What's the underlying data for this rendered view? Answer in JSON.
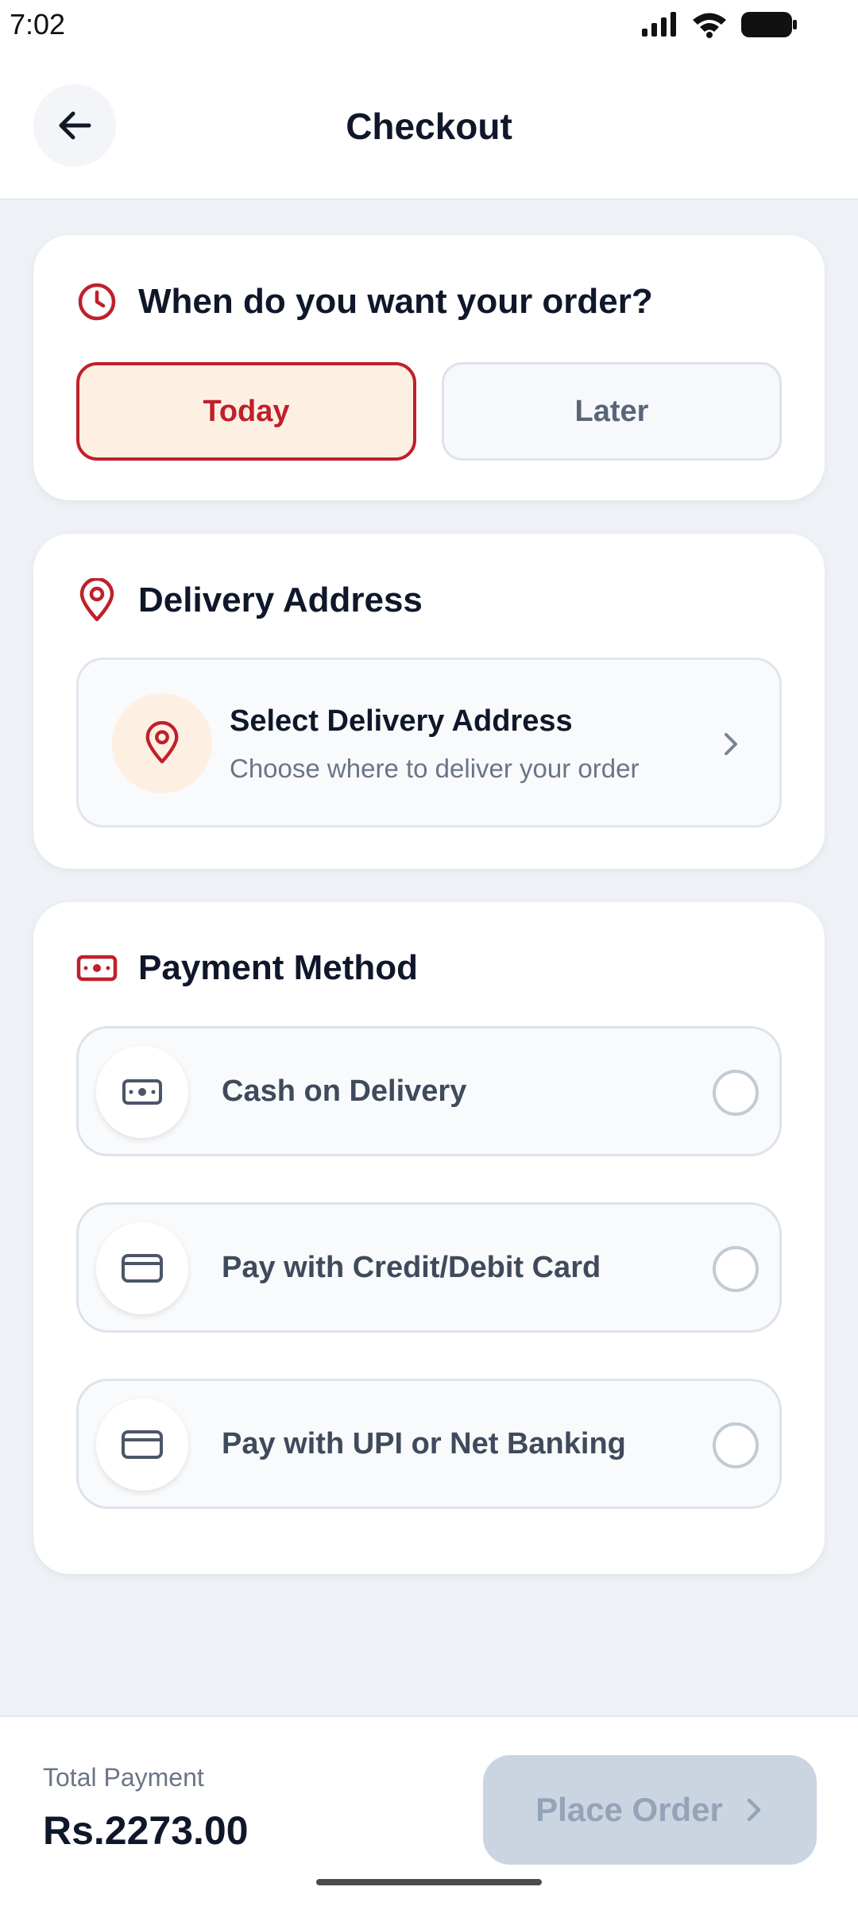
{
  "status_bar": {
    "time": "7:02"
  },
  "header": {
    "title": "Checkout"
  },
  "delivery_time": {
    "title": "When do you want your order?",
    "options": [
      "Today",
      "Later"
    ],
    "selected": "Today"
  },
  "delivery_address": {
    "title": "Delivery Address",
    "select_title": "Select Delivery Address",
    "select_subtitle": "Choose where to deliver your order"
  },
  "payment": {
    "title": "Payment Method",
    "options": [
      {
        "label": "Cash on Delivery",
        "icon": "cash-icon",
        "selected": false
      },
      {
        "label": "Pay with Credit/Debit Card",
        "icon": "card-icon",
        "selected": false
      },
      {
        "label": "Pay with UPI or Net Banking",
        "icon": "card-icon",
        "selected": false
      }
    ]
  },
  "footer": {
    "total_label": "Total Payment",
    "total_value": "Rs.2273.00",
    "place_order_label": "Place Order"
  },
  "colors": {
    "accent": "#c0202b",
    "accent_light": "#fdf0e3",
    "disabled_button": "#cbd5e1"
  }
}
